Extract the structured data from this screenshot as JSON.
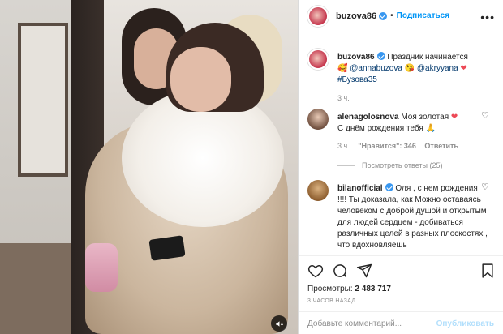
{
  "post": {
    "author": "buzova86",
    "follow_label": "Подписаться",
    "more_icon": "more-horizontal-icon",
    "caption": {
      "text": "Праздник начинается",
      "mentions": [
        "@annabuzova",
        "@akryyana"
      ],
      "hashtag": "#Бузова35",
      "time": "3 ч."
    },
    "comments": [
      {
        "user": "alenagolosnova",
        "text_line1": "Моя золотая",
        "text_line2": "С днём рождения тебя",
        "time": "3 ч.",
        "likes": "\"Нравится\": 346",
        "reply_label": "Ответить",
        "view_replies": "Посмотреть ответы (25)"
      },
      {
        "user": "bilanofficial",
        "text": "Оля , с нем рождения !!!! Ты доказала, как Можно оставаясь человеком с доброй душой и открытым для людей сердцем - добиваться различных целей в разных плоскостях , что вдохновляешь"
      }
    ],
    "views_label": "Просмотры:",
    "views_count": "2 483 717",
    "posted_ago": "3 ЧАСОВ НАЗАД",
    "add_comment_placeholder": "Добавьте комментарий...",
    "publish_label": "Опубликовать"
  },
  "colors": {
    "accent": "#0095f6",
    "verified": "#3897f0",
    "like_red": "#ed4956"
  }
}
